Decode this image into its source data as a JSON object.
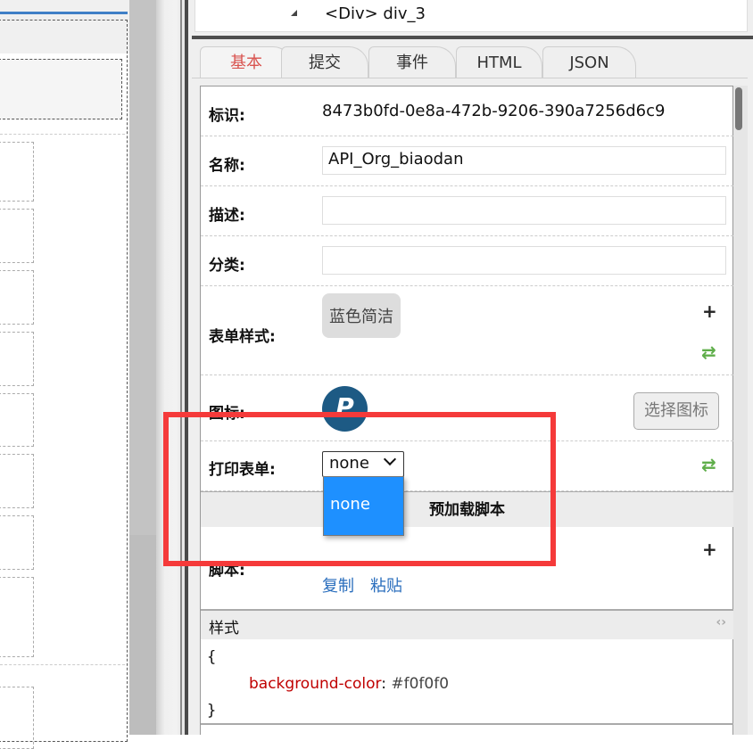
{
  "tree": {
    "node_label": "<Div> div_3"
  },
  "tabs": [
    {
      "label": "基本",
      "active": true
    },
    {
      "label": "提交"
    },
    {
      "label": "事件"
    },
    {
      "label": "HTML"
    },
    {
      "label": "JSON"
    }
  ],
  "fields": {
    "id_label": "标识:",
    "id_value": "8473b0fd-0e8a-472b-9206-390a7256d6c9",
    "name_label": "名称:",
    "name_value": "API_Org_biaodan",
    "desc_label": "描述:",
    "desc_value": "",
    "category_label": "分类:",
    "category_value": "",
    "form_style_label": "表单样式:",
    "form_style_value": "蓝色简洁",
    "icon_label": "图标:",
    "choose_icon_button": "选择图标",
    "print_form_label": "打印表单:",
    "print_form_value": "none",
    "print_form_options": [
      "none"
    ]
  },
  "preload_section": {
    "title": "预加载脚本",
    "script_label": "脚本:",
    "copy": "复制",
    "paste": "粘贴"
  },
  "style_section": {
    "title": "样式",
    "open_brace": "{",
    "property": "background-color",
    "colon": ":",
    "value": "#f0f0f0",
    "close_brace": "}"
  },
  "colors": {
    "active_tab": "#d9534f",
    "dropdown_highlight": "#1e90ff",
    "link": "#2a6ebd",
    "css_property": "#c00000",
    "annotation_box": "#f53a3a"
  }
}
